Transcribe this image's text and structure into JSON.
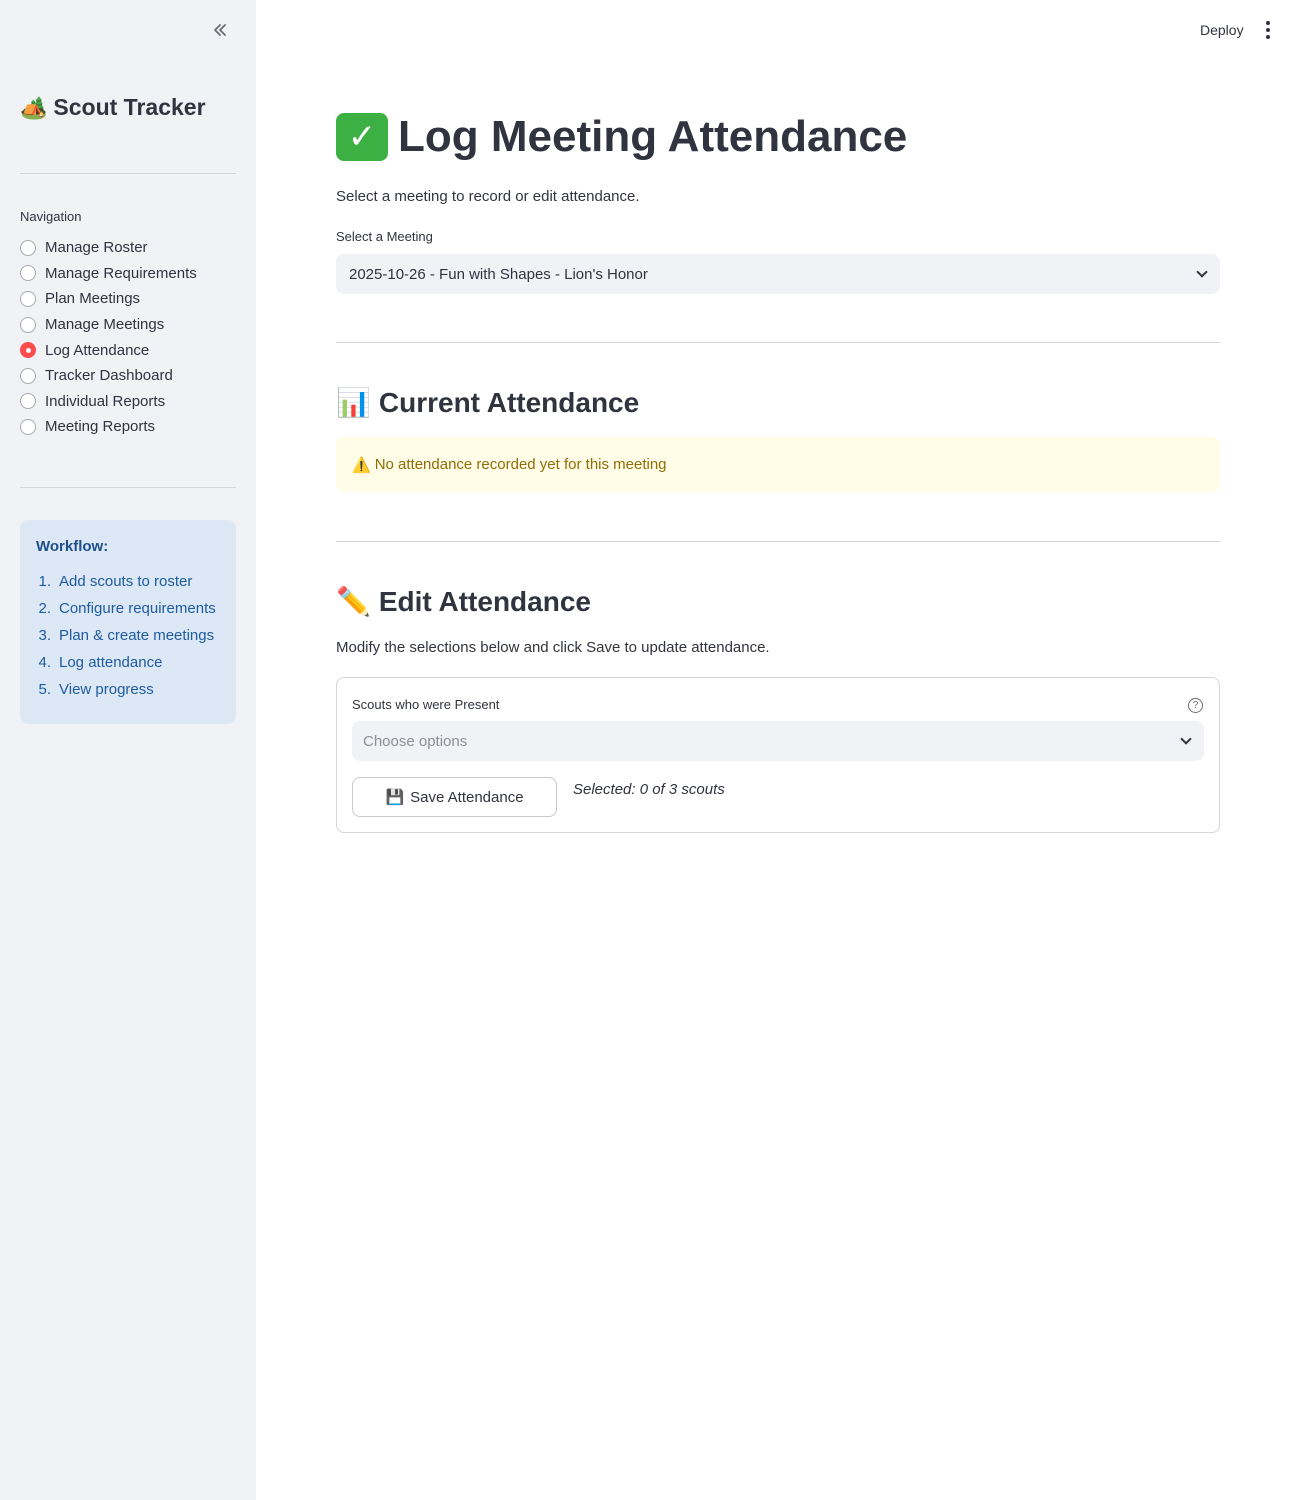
{
  "sidebar": {
    "app_title": "Scout Tracker",
    "app_emoji": "🏕️",
    "nav_label": "Navigation",
    "nav_items": [
      {
        "label": "Manage Roster",
        "selected": false
      },
      {
        "label": "Manage Requirements",
        "selected": false
      },
      {
        "label": "Plan Meetings",
        "selected": false
      },
      {
        "label": "Manage Meetings",
        "selected": false
      },
      {
        "label": "Log Attendance",
        "selected": true
      },
      {
        "label": "Tracker Dashboard",
        "selected": false
      },
      {
        "label": "Individual Reports",
        "selected": false
      },
      {
        "label": "Meeting Reports",
        "selected": false
      }
    ],
    "workflow": {
      "title": "Workflow:",
      "steps": [
        {
          "num": "1.",
          "label": "Add scouts to roster"
        },
        {
          "num": "2.",
          "label": "Configure requirements"
        },
        {
          "num": "3.",
          "label": "Plan & create meetings"
        },
        {
          "num": "4.",
          "label": "Log attendance"
        },
        {
          "num": "5.",
          "label": "View progress"
        }
      ]
    }
  },
  "header": {
    "deploy_label": "Deploy"
  },
  "main": {
    "title": "Log Meeting Attendance",
    "subtitle": "Select a meeting to record or edit attendance.",
    "meeting_select": {
      "label": "Select a Meeting",
      "value": "2025-10-26 - Fun with Shapes - Lion's Honor"
    },
    "current_attendance": {
      "heading": "Current Attendance",
      "emoji": "📊",
      "warning_icon": "⚠️",
      "warning_text": "No attendance recorded yet for this meeting"
    },
    "edit_attendance": {
      "heading": "Edit Attendance",
      "emoji": "✏️",
      "description": "Modify the selections below and click Save to update attendance.",
      "scouts_label": "Scouts who were Present",
      "scouts_placeholder": "Choose options",
      "save_icon": "💾",
      "save_label": "Save Attendance",
      "selected_text": "Selected: 0 of 3 scouts"
    }
  },
  "colors": {
    "accent": "#ff4b4b",
    "sidebar_bg": "#f0f2f6",
    "info_bg": "#dde8f6",
    "warning_bg": "#fffde8",
    "warning_text": "#926c05"
  }
}
